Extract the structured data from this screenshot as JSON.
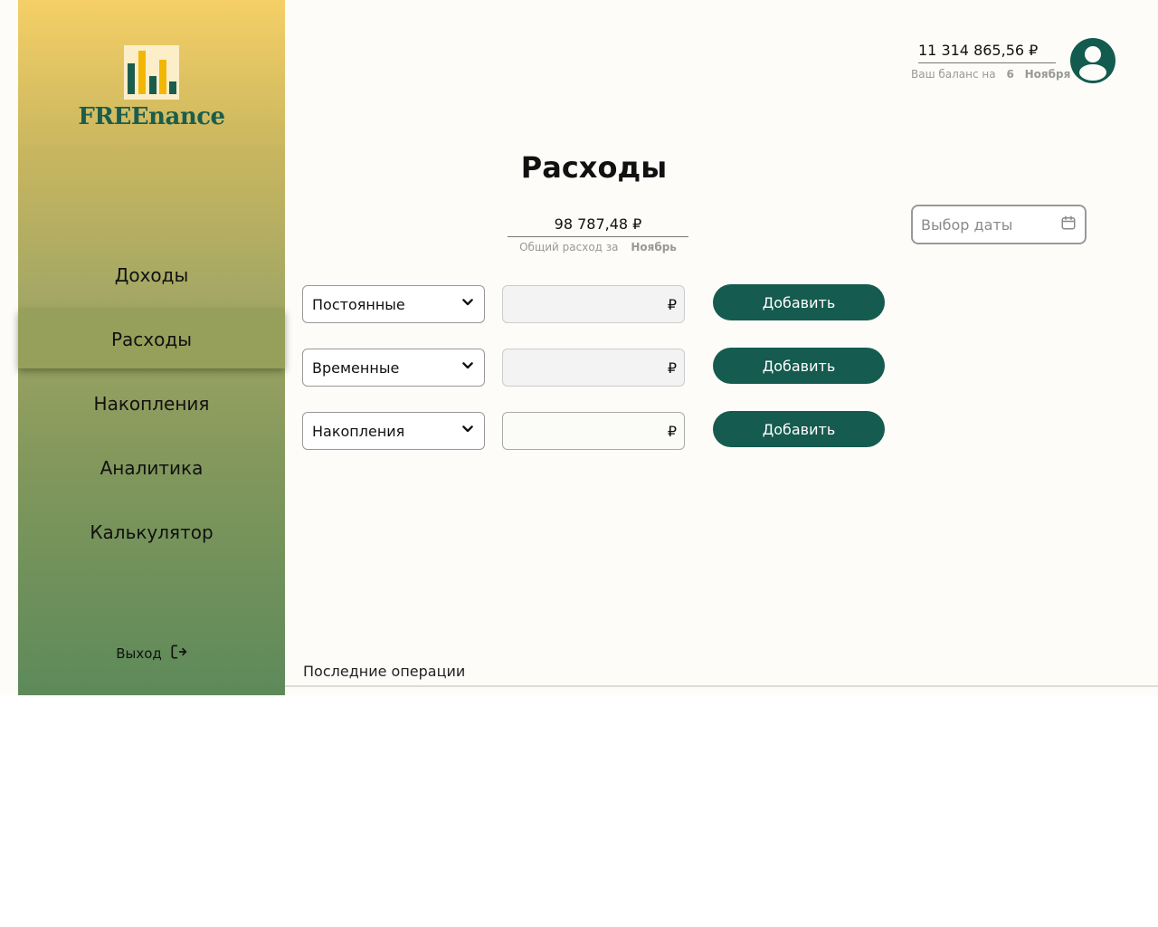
{
  "app": {
    "logo_text": "FREEnance"
  },
  "sidebar": {
    "items": [
      {
        "label": "Доходы"
      },
      {
        "label": "Расходы",
        "active": true
      },
      {
        "label": "Накопления"
      },
      {
        "label": "Аналитика"
      },
      {
        "label": "Калькулятор"
      }
    ],
    "logout_label": "Выход"
  },
  "header": {
    "balance": "11 314 865,56 ₽",
    "balance_note": "Ваш баланс на",
    "balance_day": "6",
    "balance_month": "Ноября"
  },
  "main": {
    "title": "Расходы",
    "total_value": "98 787,48 ₽",
    "total_note": "Общий расход за",
    "total_month": "Ноябрь",
    "date_placeholder": "Выбор даты",
    "rows": [
      {
        "category": "Постоянные",
        "currency": "₽",
        "button": "Добавить"
      },
      {
        "category": "Временные",
        "currency": "₽",
        "button": "Добавить"
      },
      {
        "category": "Накопления",
        "currency": "₽",
        "button": "Добавить"
      }
    ],
    "recent_label": "Последние операции"
  },
  "colors": {
    "accent": "#155b4f",
    "logo_bar_green": "#1b5d4d",
    "logo_bar_yellow": "#f2b705",
    "sidebar_top": "#f5cf66",
    "sidebar_bottom": "#5d8a5a"
  },
  "icons": {
    "logo": "bar-chart-icon",
    "logout": "logout-icon",
    "avatar": "user-icon",
    "calendar": "calendar-icon",
    "dropdown": "chevron-down-icon"
  }
}
